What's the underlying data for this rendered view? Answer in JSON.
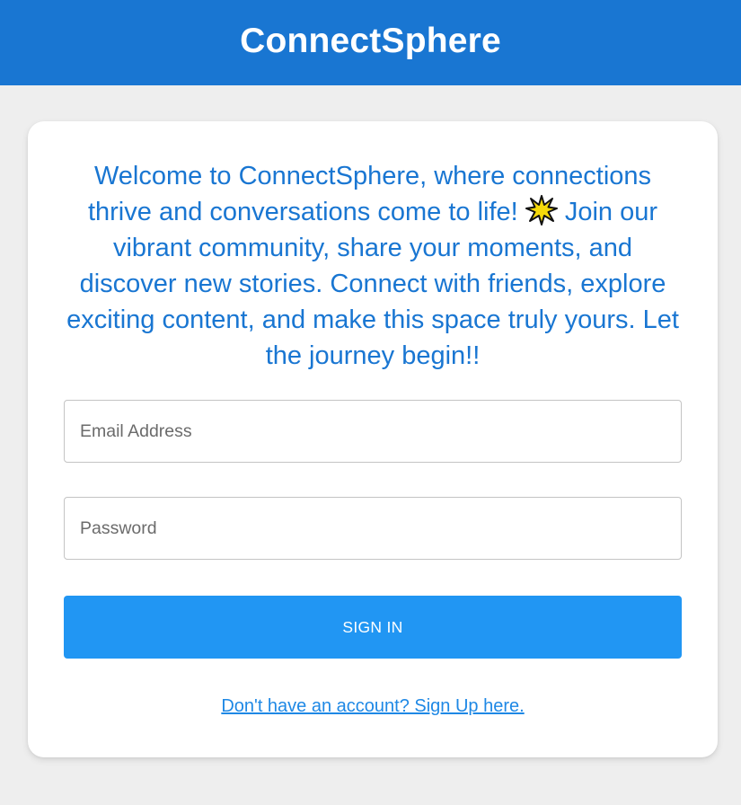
{
  "header": {
    "title": "ConnectSphere",
    "background_color": "#1976d2"
  },
  "welcome": {
    "text_before_icon": "Welcome to ConnectSphere, where connections thrive and conversations come to life!",
    "icon": "sparkle-icon",
    "text_after_icon": "Join our vibrant community, share your moments, and discover new stories. Connect with friends, explore exciting content, and make this space truly yours. Let the journey begin!!",
    "color": "#1976d2"
  },
  "form": {
    "email": {
      "value": "",
      "placeholder": "Email Address"
    },
    "password": {
      "value": "",
      "placeholder": "Password"
    },
    "submit_label": "SIGN IN",
    "submit_color": "#2196f3",
    "signup_link": "Don't have an account? Sign Up here."
  }
}
